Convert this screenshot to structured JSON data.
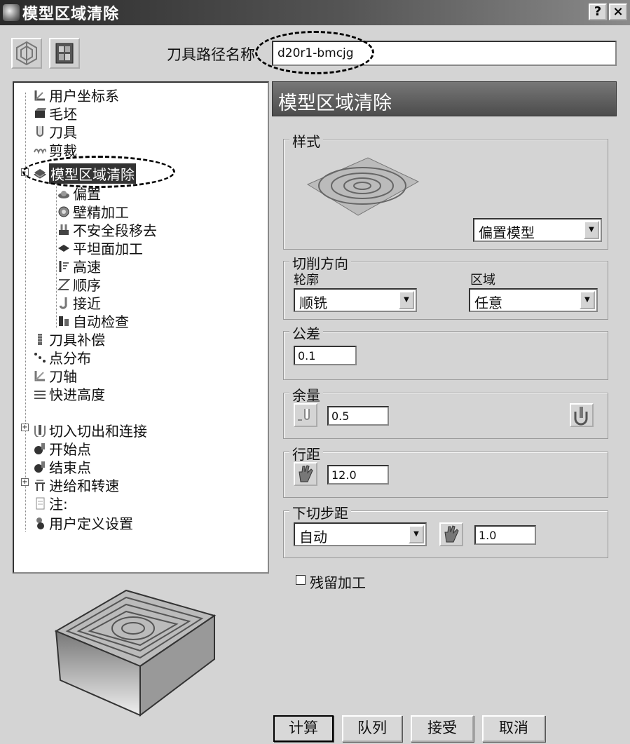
{
  "window": {
    "title": "模型区域清除",
    "help_label": "?",
    "close_label": "×"
  },
  "toolbar": {
    "path_name_label": "刀具路径名称",
    "path_name_value": "d20r1-bmcjg"
  },
  "tree": {
    "items": [
      {
        "label": "用户坐标系",
        "icon": "user-coordinate-icon"
      },
      {
        "label": "毛坯",
        "icon": "block-icon"
      },
      {
        "label": "刀具",
        "icon": "tool-icon"
      },
      {
        "label": "剪裁",
        "icon": "limit-icon"
      },
      {
        "label": "模型区域清除",
        "icon": "area-clearance-icon",
        "selected": true
      },
      {
        "label": "偏置",
        "icon": "offset-icon"
      },
      {
        "label": "壁精加工",
        "icon": "wall-finishing-icon"
      },
      {
        "label": "不安全段移去",
        "icon": "unsafe-segment-icon"
      },
      {
        "label": "平坦面加工",
        "icon": "flat-machining-icon"
      },
      {
        "label": "高速",
        "icon": "high-speed-icon"
      },
      {
        "label": "顺序",
        "icon": "order-icon"
      },
      {
        "label": "接近",
        "icon": "approach-icon"
      },
      {
        "label": "自动检查",
        "icon": "auto-verify-icon"
      },
      {
        "label": "刀具补偿",
        "icon": "tool-compensation-icon"
      },
      {
        "label": "点分布",
        "icon": "point-distribution-icon"
      },
      {
        "label": "刀轴",
        "icon": "tool-axis-icon"
      },
      {
        "label": "快进高度",
        "icon": "rapid-height-icon"
      },
      {
        "label": "切入切出和连接",
        "icon": "leads-links-icon"
      },
      {
        "label": "开始点",
        "icon": "start-point-icon"
      },
      {
        "label": "结束点",
        "icon": "end-point-icon"
      },
      {
        "label": "进给和转速",
        "icon": "feeds-speeds-icon"
      },
      {
        "label": "注:",
        "icon": "notes-icon"
      },
      {
        "label": "用户定义设置",
        "icon": "user-settings-icon"
      }
    ]
  },
  "panel": {
    "header": "模型区域清除",
    "style": {
      "title": "样式",
      "value": "偏置模型"
    },
    "cut_direction": {
      "title": "切削方向",
      "profile_label": "轮廓",
      "profile_value": "顺铣",
      "area_label": "区域",
      "area_value": "任意"
    },
    "tolerance": {
      "title": "公差",
      "value": "0.1"
    },
    "thickness": {
      "title": "余量",
      "value": "0.5"
    },
    "stepover": {
      "title": "行距",
      "value": "12.0"
    },
    "stepdown": {
      "title": "下切步距",
      "mode": "自动",
      "value": "1.0"
    },
    "rest_machining_label": "残留加工"
  },
  "buttons": {
    "calculate": "计算",
    "queue": "队列",
    "accept": "接受",
    "cancel": "取消"
  }
}
